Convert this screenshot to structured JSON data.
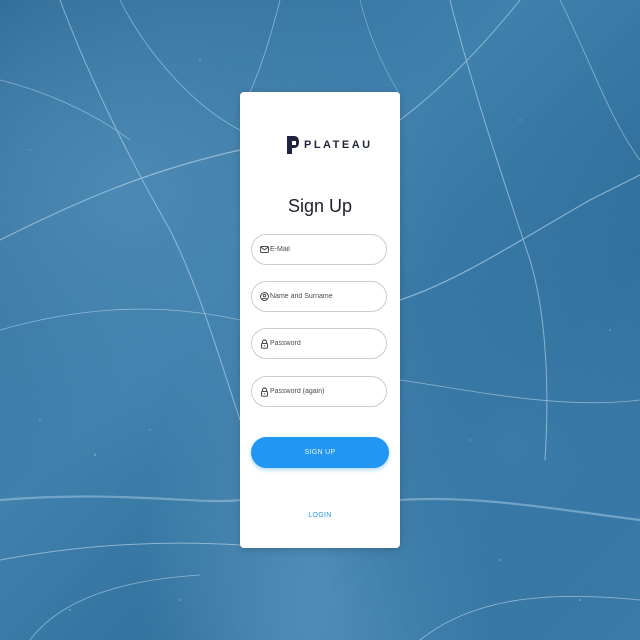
{
  "brand": {
    "name": "PLATEAU",
    "icon": "plateau-logo-mark",
    "color": "#1f2440"
  },
  "form": {
    "title": "Sign Up",
    "fields": [
      {
        "placeholder": "E-Mail",
        "icon": "mail-icon"
      },
      {
        "placeholder": "Name and Surname",
        "icon": "user-circle-icon"
      },
      {
        "placeholder": "Password",
        "icon": "lock-icon"
      },
      {
        "placeholder": "Password (again)",
        "icon": "lock-icon"
      }
    ],
    "submit_label": "SIGN UP",
    "login_label": "LOGIN"
  },
  "colors": {
    "accent": "#2196f3",
    "background": "#3f80ad",
    "card": "#ffffff"
  }
}
